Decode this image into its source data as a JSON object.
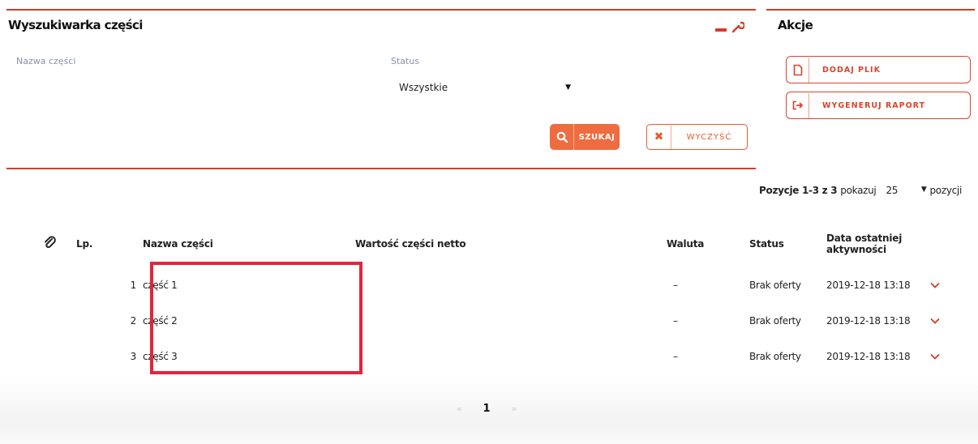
{
  "search_panel": {
    "title": "Wyszukiwarka części",
    "name_label": "Nazwa części",
    "status_label": "Status",
    "status_value": "Wszystkie",
    "search_button": "SZUKAJ",
    "clear_button": "WYCZYŚĆ",
    "accent_color": "#d63a2a"
  },
  "actions_panel": {
    "title": "Akcje",
    "add_file_button": "DODAJ PLIK",
    "generate_report_button": "WYGENERUJ RAPORT"
  },
  "pager_info": {
    "range": "Pozycje 1-3 z 3",
    "show_label": "pokazuj",
    "page_size": "25",
    "items_label": "pozycji"
  },
  "table": {
    "columns": {
      "lp": "Lp.",
      "name": "Nazwa części",
      "value": "Wartość części netto",
      "currency": "Waluta",
      "status": "Status",
      "last_activity": "Data ostatniej aktywności"
    },
    "rows": [
      {
        "lp": "1",
        "name": "część 1",
        "value": "",
        "currency": "–",
        "status": "Brak oferty",
        "date": "2019-12-18 13:18"
      },
      {
        "lp": "2",
        "name": "część 2",
        "value": "",
        "currency": "–",
        "status": "Brak oferty",
        "date": "2019-12-18 13:18"
      },
      {
        "lp": "3",
        "name": "część 3",
        "value": "",
        "currency": "–",
        "status": "Brak oferty",
        "date": "2019-12-18 13:18"
      }
    ]
  },
  "pagination": {
    "prev": "«",
    "current": "1",
    "next": "»"
  }
}
